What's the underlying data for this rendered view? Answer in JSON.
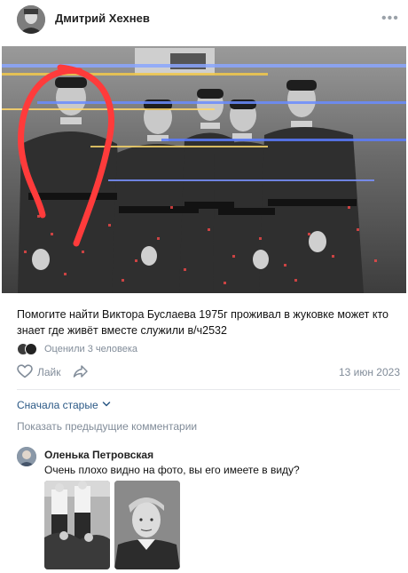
{
  "post": {
    "author": "Дмитрий Хехнев",
    "more_label": "•••",
    "caption": "Помогите найти Виктора Буслаева 1975г проживал в жуковке может кто знает где живёт вместе служили в/ч2532",
    "reactions_text": "Оценили 3 человека",
    "like_label": "Лайк",
    "date": "13 июн 2023"
  },
  "comments": {
    "sort_label": "Сначала старые",
    "show_previous_label": "Показать предыдущие комментарии",
    "items": [
      {
        "author": "Оленька Петровская",
        "text": "Очень плохо видно на фото, вы его имеете в виду?"
      }
    ]
  },
  "colors": {
    "link": "#2a5885",
    "secondary": "#818c99",
    "annotation_red": "#ff3b3b"
  },
  "icons": [
    "more-dots-icon",
    "like-heart-icon",
    "share-arrow-icon",
    "chevron-down-icon"
  ]
}
